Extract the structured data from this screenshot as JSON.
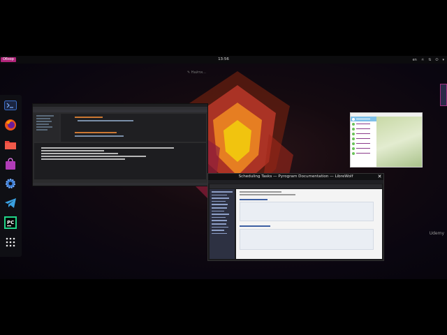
{
  "topbar": {
    "activities": "Обзор",
    "clock": "13:56",
    "lang": "en"
  },
  "search_placeholder": "Найти…",
  "dock": [
    {
      "name": "terminal-icon"
    },
    {
      "name": "firefox-icon"
    },
    {
      "name": "files-icon"
    },
    {
      "name": "software-store-icon"
    },
    {
      "name": "settings-icon"
    },
    {
      "name": "telegram-icon"
    },
    {
      "name": "pycharm-icon"
    },
    {
      "name": "apps-grid-icon"
    }
  ],
  "browser": {
    "title": "Scheduling Tasks — Pyrogram Documentation — LibreWolf"
  },
  "watermark": "Udemy",
  "colors": {
    "accent": "#b0247a",
    "ide_bg": "#2b2b2d"
  }
}
